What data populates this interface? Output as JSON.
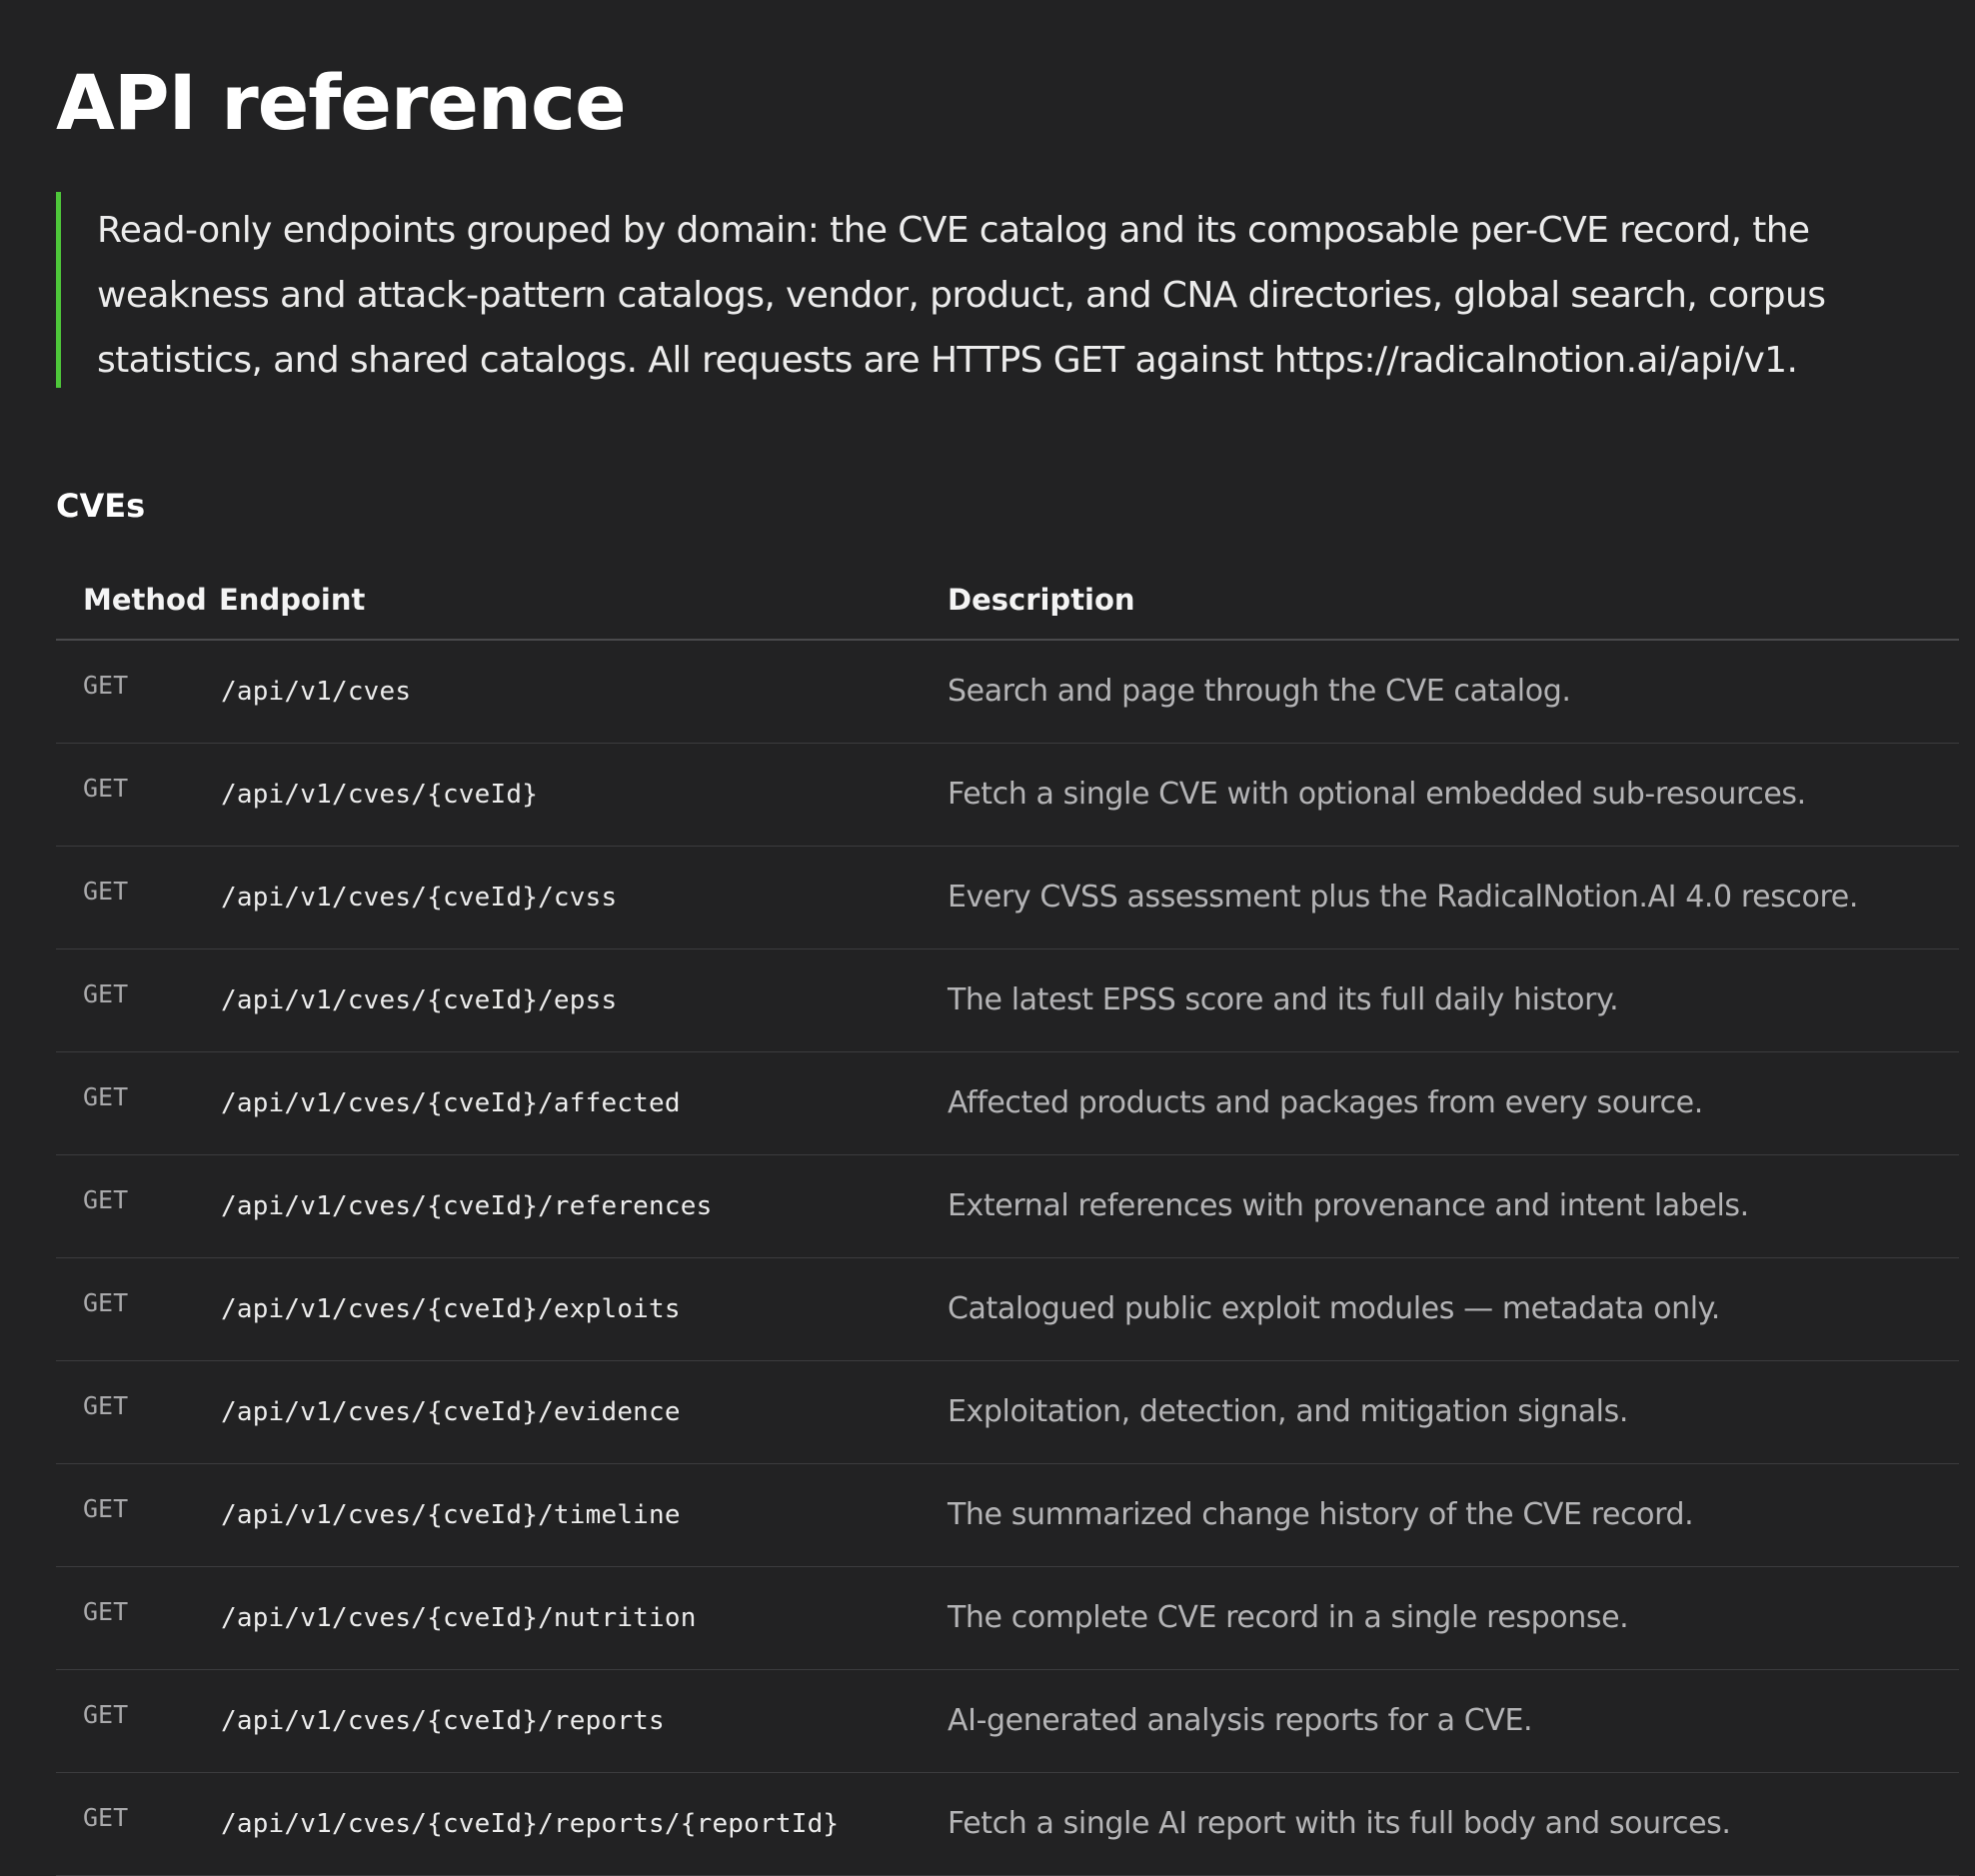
{
  "page": {
    "title": "API reference",
    "intro": "Read-only endpoints grouped by domain: the CVE catalog and its composable per-CVE record, the weakness and attack-pattern catalogs, vendor, product, and CNA directories, global search, corpus statistics, and shared catalogs. All requests are HTTPS GET against https://radicalnotion.ai/api/v1."
  },
  "colors": {
    "background": "#222223",
    "accent_bar": "#4ec73a"
  },
  "section": {
    "title": "CVEs",
    "columns": {
      "method": "Method",
      "endpoint": "Endpoint",
      "description": "Description"
    },
    "rows": [
      {
        "method": "GET",
        "endpoint": "/api/v1/cves",
        "description": "Search and page through the CVE catalog."
      },
      {
        "method": "GET",
        "endpoint": "/api/v1/cves/{cveId}",
        "description": "Fetch a single CVE with optional embedded sub-resources."
      },
      {
        "method": "GET",
        "endpoint": "/api/v1/cves/{cveId}/cvss",
        "description": "Every CVSS assessment plus the RadicalNotion.AI 4.0 rescore."
      },
      {
        "method": "GET",
        "endpoint": "/api/v1/cves/{cveId}/epss",
        "description": "The latest EPSS score and its full daily history."
      },
      {
        "method": "GET",
        "endpoint": "/api/v1/cves/{cveId}/affected",
        "description": "Affected products and packages from every source."
      },
      {
        "method": "GET",
        "endpoint": "/api/v1/cves/{cveId}/references",
        "description": "External references with provenance and intent labels."
      },
      {
        "method": "GET",
        "endpoint": "/api/v1/cves/{cveId}/exploits",
        "description": "Catalogued public exploit modules — metadata only."
      },
      {
        "method": "GET",
        "endpoint": "/api/v1/cves/{cveId}/evidence",
        "description": "Exploitation, detection, and mitigation signals."
      },
      {
        "method": "GET",
        "endpoint": "/api/v1/cves/{cveId}/timeline",
        "description": "The summarized change history of the CVE record."
      },
      {
        "method": "GET",
        "endpoint": "/api/v1/cves/{cveId}/nutrition",
        "description": "The complete CVE record in a single response."
      },
      {
        "method": "GET",
        "endpoint": "/api/v1/cves/{cveId}/reports",
        "description": "AI-generated analysis reports for a CVE."
      },
      {
        "method": "GET",
        "endpoint": "/api/v1/cves/{cveId}/reports/{reportId}",
        "description": "Fetch a single AI report with its full body and sources."
      }
    ]
  }
}
